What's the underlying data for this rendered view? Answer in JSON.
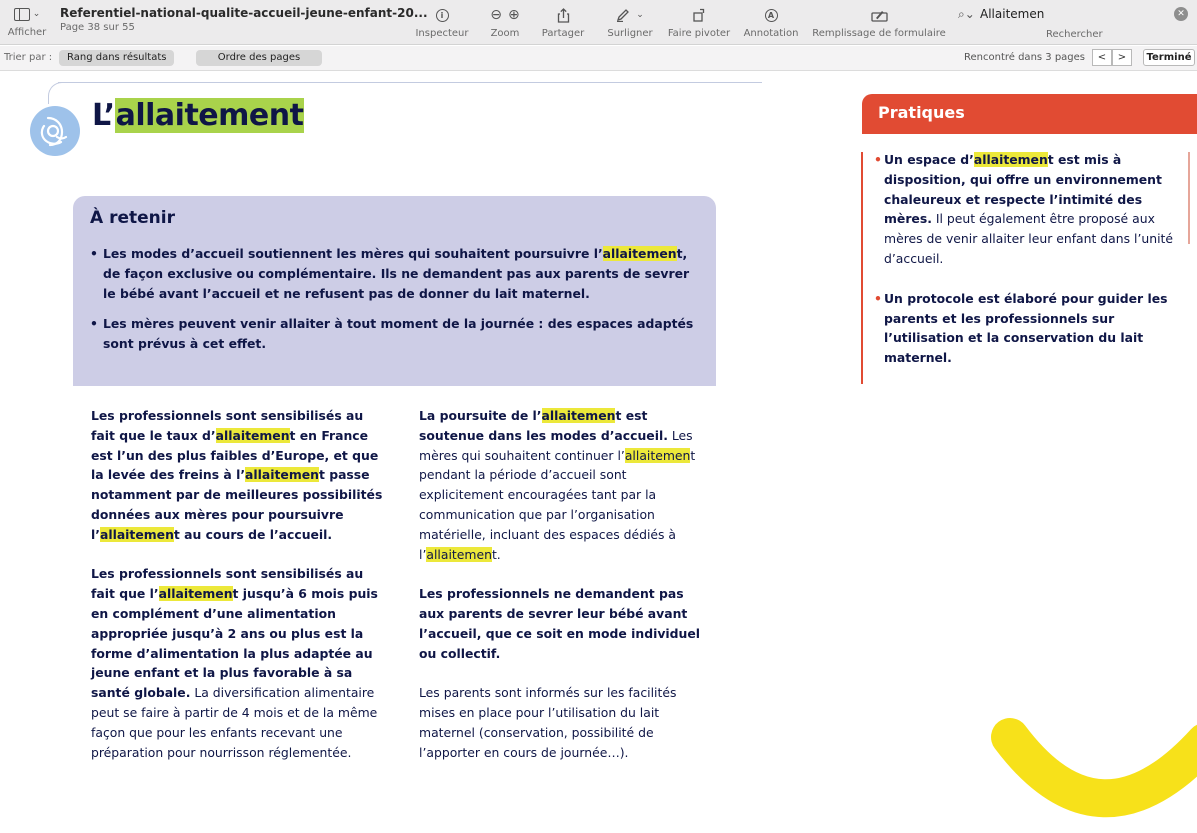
{
  "toolbar": {
    "afficher_label": "Afficher",
    "file_name": "Referentiel-national-qualite-accueil-jeune-enfant-20...",
    "page_info": "Page 38 sur 55",
    "buttons": {
      "inspector": "Inspecteur",
      "zoom": "Zoom",
      "share": "Partager",
      "highlight": "Surligner",
      "rotate": "Faire pivoter",
      "annotation": "Annotation",
      "form_fill": "Remplissage de formulaire",
      "search": "Rechercher"
    },
    "search_value": "Allaitemen",
    "icons": {
      "sidebar": "sidebar-icon",
      "info": "info-icon",
      "zoom_out": "zoom-out-icon",
      "zoom_in": "zoom-in-icon",
      "share": "share-icon",
      "highlighter": "highlighter-icon",
      "rotate": "rotate-icon",
      "annotation": "annotation-icon",
      "form": "form-icon",
      "search": "search-icon",
      "clear": "clear-icon"
    }
  },
  "sortbar": {
    "label": "Trier par :",
    "by_rank": "Rang dans résultats",
    "by_page": "Ordre des pages",
    "found_text": "Rencontré dans 3 pages",
    "prev": "<",
    "next": ">",
    "done": "Terminé"
  },
  "document": {
    "title_prefix": "L’",
    "title_hl": "allaitement",
    "retenir": {
      "heading": "À retenir",
      "item1_a": "Les modes d’accueil soutiennent les mères qui souhaitent poursuivre l’",
      "item1_hl": "allaitemen",
      "item1_b": "t, de façon exclusive ou complémentaire. Ils ne demandent pas aux parents de sevrer le bébé avant l’accueil et ne refusent pas de donner du lait maternel.",
      "item2": "Les mères peuvent venir allaiter à tout moment de la journée : des espaces adaptés sont prévus à cet effet."
    },
    "col1": {
      "p1_a": "Les professionnels sont sensibilisés au fait que le taux d’",
      "p1_hl1": "allaitemen",
      "p1_b": "t en France est l’un des plus faibles d’Europe, et que la levée des freins à l’",
      "p1_hl2": "allaitemen",
      "p1_c": "t passe notamment par de meilleures possibilités données aux mères pour poursuivre l’",
      "p1_hl3": "allaitemen",
      "p1_d": "t au cours de l’accueil.",
      "p2_a": "Les professionnels sont sensibilisés au fait que l’",
      "p2_hl": "allaitemen",
      "p2_b": "t jusqu’à 6 mois puis en complément d’une alimentation appropriée jusqu’à 2 ans ou plus est la forme d’alimentation la plus adaptée au jeune enfant et la plus favorable à sa santé globale.",
      "p2_c": " La diversification alimentaire peut se faire à partir de 4 mois et de la même façon que pour les enfants recevant une préparation pour nourrisson réglementée."
    },
    "col2": {
      "p1_a": "La poursuite de l’",
      "p1_hl": "allaitemen",
      "p1_b": "t est soutenue dans les modes d’accueil.",
      "p1_c": " Les mères qui souhaitent continuer l’",
      "p1_hl2": "allaitemen",
      "p1_d": "t pendant la période d’accueil sont explicitement encouragées tant par la communication que par l’organisation matérielle, incluant des espaces dédiés à l’",
      "p1_hl3": "allaitemen",
      "p1_e": "t.",
      "p2": "Les professionnels ne demandent pas aux parents de sevrer leur bébé avant l’accueil, que ce soit en mode individuel ou collectif.",
      "p3": "Les parents sont informés sur les facilités mises en place pour l’utilisation du lait maternel (conservation, possibilité de l’apporter en cours de journée…)."
    },
    "pratiques": {
      "heading": "Pratiques",
      "item1_a": "Un espace d’",
      "item1_hl": "allaitemen",
      "item1_b": "t est mis à disposition, qui offre un environnement chaleureux et respecte l’intimité des mères.",
      "item1_c": " Il peut également être proposé aux mères de venir allaiter leur enfant dans l’unité d’accueil.",
      "item2": "Un protocole est élaboré pour guider les parents et les professionnels sur l’utilisation et la conservation du lait maternel."
    },
    "colors": {
      "navy": "#0f1646",
      "highlight_yellow": "#ece83a",
      "title_highlight_green": "#a9d34b",
      "retenir_bg": "#cdcde6",
      "pratiques_red": "#e14b33",
      "deco_yellow": "#f7e11a",
      "logo_blue": "#9ec2ea"
    }
  }
}
